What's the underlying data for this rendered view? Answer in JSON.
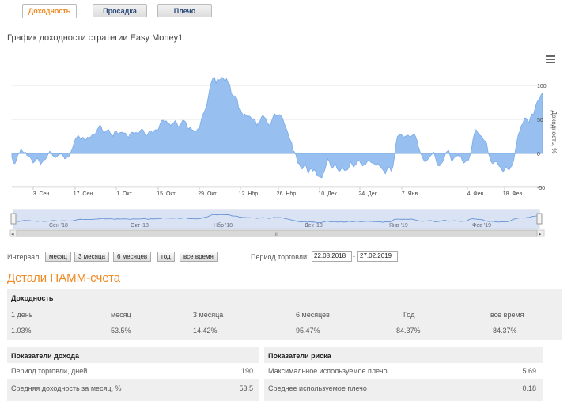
{
  "tabs": [
    {
      "label": "Доходность",
      "active": true
    },
    {
      "label": "Просадка",
      "active": false
    },
    {
      "label": "Плечо",
      "active": false
    }
  ],
  "chart_title": "График доходности стратегии Easy Money1",
  "chart_data": {
    "type": "area",
    "title": "",
    "ylabel": "Доходность, %",
    "ylim": [
      -55,
      110
    ],
    "yticks": [
      100,
      50,
      0,
      -50
    ],
    "xticks": [
      "3. Сен",
      "17. Сен",
      "1. Окт",
      "15. Окт",
      "29. Окт",
      "12. Нбр",
      "26. Нбр",
      "10. Дек",
      "24. Дек",
      "7. Янв",
      "4. Фев",
      "18. Фев"
    ],
    "x_range": [
      "22.08.2018",
      "27.02.2019"
    ],
    "values": [
      -5,
      -14,
      -15,
      -10,
      -2,
      1,
      6,
      3,
      1,
      2,
      -3,
      -4,
      -5,
      -9,
      -14,
      -12,
      -9,
      -7,
      -11,
      -16,
      -13,
      -10,
      -9,
      -6,
      -1,
      3,
      2,
      -3,
      -5,
      -6,
      -4,
      -2,
      -1,
      -1,
      -4,
      -8,
      -7,
      -4,
      -4,
      2,
      7,
      15,
      21,
      24,
      26,
      23,
      21,
      24,
      20,
      20,
      24,
      23,
      24,
      27,
      28,
      28,
      33,
      37,
      41,
      40,
      33,
      30,
      33,
      34,
      35,
      30,
      28,
      25,
      32,
      33,
      29,
      30,
      31,
      31,
      30,
      30,
      27,
      23,
      28,
      31,
      31,
      29,
      31,
      30,
      30,
      34,
      36,
      34,
      28,
      25,
      29,
      33,
      33,
      30,
      33,
      35,
      34,
      36,
      43,
      48,
      49,
      46,
      48,
      45,
      44,
      41,
      44,
      45,
      48,
      45,
      39,
      41,
      44,
      49,
      48,
      46,
      38,
      36,
      39,
      35,
      34,
      32,
      33,
      36,
      37,
      47,
      56,
      60,
      65,
      72,
      84,
      97,
      105,
      111,
      112,
      103,
      109,
      108,
      109,
      112,
      110,
      106,
      110,
      104,
      102,
      90,
      84,
      85,
      84,
      80,
      66,
      65,
      60,
      56,
      58,
      56,
      54,
      55,
      53,
      50,
      51,
      48,
      41,
      45,
      47,
      53,
      56,
      53,
      51,
      45,
      42,
      42,
      49,
      55,
      58,
      55,
      56,
      57,
      55,
      52,
      45,
      39,
      34,
      27,
      20,
      16,
      4,
      2,
      -3,
      -14,
      -15,
      -20,
      -23,
      -19,
      -15,
      -22,
      -30,
      -24,
      -22,
      -26,
      -24,
      -27,
      -33,
      -34,
      -35,
      -36,
      -30,
      -24,
      -16,
      -8,
      -12,
      -20,
      -22,
      -18,
      -15,
      -22,
      -25,
      -26,
      -22,
      -22,
      -25,
      -25,
      -24,
      -20,
      -12,
      -16,
      -20,
      -17,
      -15,
      -10,
      -11,
      -16,
      -18,
      -17,
      -16,
      -12,
      -10,
      -12,
      -14,
      -14,
      -16,
      -18,
      -15,
      -18,
      -20,
      -23,
      -26,
      -30,
      -24,
      -20,
      -22,
      -26,
      -20,
      -5,
      14,
      25,
      27,
      28,
      27,
      24,
      25,
      26,
      27,
      25,
      25,
      27,
      29,
      25,
      19,
      9,
      2,
      -3,
      -8,
      -12,
      -11,
      -9,
      -6,
      -3,
      -1,
      2,
      -5,
      -14,
      -18,
      -18,
      -15,
      -12,
      -6,
      1,
      3,
      4,
      -5,
      -12,
      -8,
      -5,
      -4,
      -3,
      -4,
      -5,
      -11,
      -14,
      -12,
      -9,
      -10,
      -3,
      7,
      21,
      30,
      35,
      31,
      28,
      26,
      24,
      20,
      18,
      15,
      1,
      -5,
      -12,
      -15,
      -13,
      -12,
      -13,
      -18,
      -20,
      -24,
      -27,
      -23,
      -19,
      -23,
      -24,
      -20,
      -17,
      -9,
      4,
      17,
      28,
      33,
      41,
      44,
      52,
      52,
      49,
      45,
      53,
      58,
      57,
      66,
      74,
      78,
      80,
      86,
      89
    ]
  },
  "navigator": {
    "labels": [
      "Сен '18",
      "Окт '18",
      "Нбр '18",
      "Дек '18",
      "Янв '19",
      "Фев '19"
    ],
    "scroll_left": "◂",
    "scroll_right": "▸",
    "scroll_grip": "III"
  },
  "controls": {
    "interval_label": "Интервал:",
    "buttons": [
      "месяц",
      "3 месяца",
      "6 месяцев",
      "год",
      "все время"
    ],
    "period_label": "Период торговли:",
    "date_from": "22.08.2018",
    "date_sep": "-",
    "date_to": "27.02.2019"
  },
  "details_title": "Детали ПАММ-счета",
  "returns": {
    "title": "Доходность",
    "columns": [
      "1 день",
      "месяц",
      "3 месяца",
      "6 месяцев",
      "Год",
      "все время"
    ],
    "values": [
      "1.03%",
      "53.5%",
      "14.42%",
      "95.47%",
      "84.37%",
      "84.37%"
    ]
  },
  "income": {
    "title": "Показатели дохода",
    "rows": [
      {
        "label": "Период торговли, дней",
        "value": "190"
      },
      {
        "label": "Средняя доходность за месяц, %",
        "value": "53.5"
      }
    ]
  },
  "risk": {
    "title": "Показатели риска",
    "rows": [
      {
        "label": "Максимальное используемое плечо",
        "value": "5.69"
      },
      {
        "label": "Среднее используемое плечо",
        "value": "0.18"
      }
    ]
  },
  "colors": {
    "accent": "#f08a24",
    "area_fill": "#97c0f0",
    "area_line": "#7aaae6",
    "panel_bg": "#efefef"
  }
}
